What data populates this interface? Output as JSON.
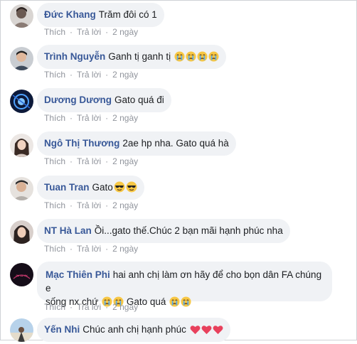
{
  "actions": {
    "like": "Thích",
    "reply": "Trả lời",
    "sep": "·"
  },
  "comments": [
    {
      "name": "Đức Khang",
      "text": "Trăm đôi có 1",
      "time": "2 ngày",
      "emoji": []
    },
    {
      "name": "Trình Nguyễn",
      "text": "Ganh tị ganh tị",
      "time": "2 ngày",
      "emoji": [
        "crying-face",
        "crying-face",
        "crying-face",
        "crying-face"
      ]
    },
    {
      "name": "Dương Dương",
      "text": "Gato quá đi",
      "time": "2 ngày",
      "emoji": []
    },
    {
      "name": "Ngô Thị Thương",
      "text": "2ae hp nha. Gato quá hà",
      "time": "2 ngày",
      "emoji": []
    },
    {
      "name": "Tuan Tran",
      "text": "Gato",
      "time": "2 ngày",
      "emoji": [
        "sunglasses-face",
        "sunglasses-face"
      ]
    },
    {
      "name": "NT Hà Lan",
      "text": "Ồi...gato thế.Chúc 2 bạn mãi hạnh phúc nha",
      "time": "2 ngày",
      "emoji": []
    },
    {
      "name": "Mạc Thiên Phi",
      "text": "hai anh chị làm ơn hãy để cho bọn dân FA chúng e",
      "text2a": "sống nx chứ",
      "text2b": "Gato quá",
      "time": "2 ngày",
      "emoji": [
        "crying-face",
        "crying-face"
      ]
    },
    {
      "name": "Yến Nhi",
      "text": "Chúc anh chị hạnh phúc",
      "time": "",
      "emoji": [
        "red-heart",
        "red-heart",
        "red-heart"
      ]
    }
  ]
}
